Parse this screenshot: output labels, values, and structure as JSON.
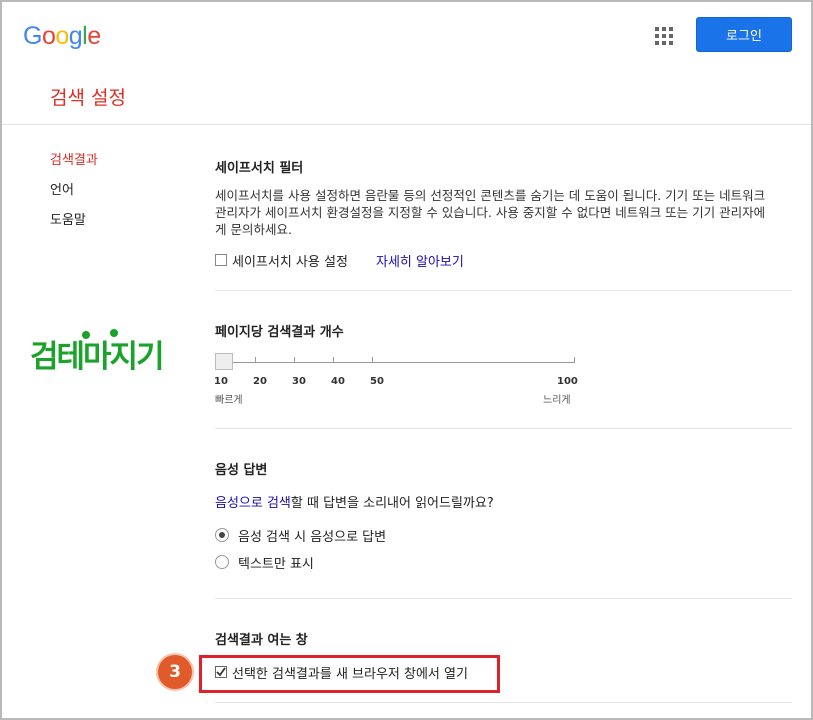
{
  "header": {
    "logo_letters": [
      {
        "ch": "G",
        "color": "#4285F4"
      },
      {
        "ch": "o",
        "color": "#EA4335"
      },
      {
        "ch": "o",
        "color": "#FBBC05"
      },
      {
        "ch": "g",
        "color": "#4285F4"
      },
      {
        "ch": "l",
        "color": "#34A853"
      },
      {
        "ch": "e",
        "color": "#EA4335"
      }
    ],
    "apps_icon": "grid-apps-icon",
    "login_label": "로그인"
  },
  "page": {
    "title": "검색 설정"
  },
  "sidebar": {
    "items": [
      {
        "label": "검색결과",
        "active": true
      },
      {
        "label": "언어",
        "active": false
      },
      {
        "label": "도움말",
        "active": false
      }
    ]
  },
  "sticker": {
    "text": "검테마지기"
  },
  "safesearch": {
    "title": "세이프서치 필터",
    "description": "세이프서치를 사용 설정하면 음란물 등의 선정적인 콘텐츠를 숨기는 데 도움이 됩니다. 기기 또는 네트워크 관리자가 세이프서치 환경설정을 지정할 수 있습니다. 사용 중지할 수 없다면 네트워크 또는 기기 관리자에게 문의하세요.",
    "checkbox_label": "세이프서치 사용 설정",
    "checked": false,
    "learn_more": "자세히 알아보기"
  },
  "results_per_page": {
    "title": "페이지당 검색결과 개수",
    "ticks": [
      "10",
      "20",
      "30",
      "40",
      "50",
      "100"
    ],
    "selected": "10",
    "fast_label": "빠르게",
    "slow_label": "느리게"
  },
  "voice": {
    "title": "음성 답변",
    "question_link": "음성으로 검색",
    "question_rest": "할 때 답변을 소리내어 읽어드릴까요?",
    "options": [
      {
        "label": "음성 검색 시 음성으로 답변",
        "selected": true
      },
      {
        "label": "텍스트만 표시",
        "selected": false
      }
    ]
  },
  "open_window": {
    "title": "검색결과 여는 창",
    "checkbox_label": "선택한 검색결과를 새 브라우저 창에서 열기",
    "checked": true,
    "step_badge": "3",
    "highlight_color": "#e0212a"
  }
}
